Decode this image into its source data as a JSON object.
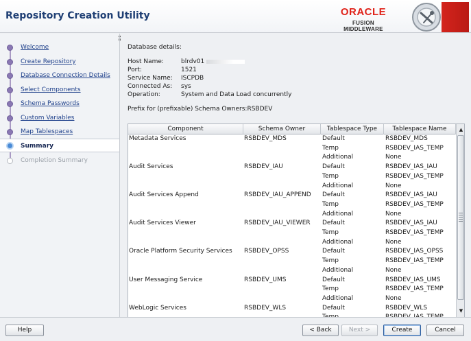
{
  "header": {
    "title": "Repository Creation Utility",
    "brand_primary": "ORACLE",
    "brand_secondary": "FUSION MIDDLEWARE",
    "brand_color": "#e0231a"
  },
  "nav": {
    "items": [
      {
        "label": "Welcome",
        "state": "done"
      },
      {
        "label": "Create Repository",
        "state": "done"
      },
      {
        "label": "Database Connection Details",
        "state": "done"
      },
      {
        "label": "Select Components",
        "state": "done"
      },
      {
        "label": "Schema Passwords",
        "state": "done"
      },
      {
        "label": "Custom Variables",
        "state": "done"
      },
      {
        "label": "Map Tablespaces",
        "state": "done"
      },
      {
        "label": "Summary",
        "state": "current"
      },
      {
        "label": "Completion Summary",
        "state": "pending"
      }
    ]
  },
  "details": {
    "heading": "Database details:",
    "rows": [
      {
        "key": "Host Name:",
        "value": "blrdv01"
      },
      {
        "key": "Port:",
        "value": "1521"
      },
      {
        "key": "Service Name:",
        "value": "ISCPDB"
      },
      {
        "key": "Connected As:",
        "value": "sys"
      },
      {
        "key": "Operation:",
        "value": "System and Data Load concurrently"
      }
    ],
    "prefix_line": "Prefix for (prefixable) Schema Owners:RSBDEV"
  },
  "table": {
    "columns": [
      "Component",
      "Schema Owner",
      "Tablespace Type",
      "Tablespace Name"
    ],
    "rows": [
      [
        "Metadata Services",
        "RSBDEV_MDS",
        "Default",
        "RSBDEV_MDS"
      ],
      [
        "",
        "",
        "Temp",
        "RSBDEV_IAS_TEMP"
      ],
      [
        "",
        "",
        "Additional",
        "None"
      ],
      [
        "Audit Services",
        "RSBDEV_IAU",
        "Default",
        "RSBDEV_IAS_IAU"
      ],
      [
        "",
        "",
        "Temp",
        "RSBDEV_IAS_TEMP"
      ],
      [
        "",
        "",
        "Additional",
        "None"
      ],
      [
        "Audit Services Append",
        "RSBDEV_IAU_APPEND",
        "Default",
        "RSBDEV_IAS_IAU"
      ],
      [
        "",
        "",
        "Temp",
        "RSBDEV_IAS_TEMP"
      ],
      [
        "",
        "",
        "Additional",
        "None"
      ],
      [
        "Audit Services Viewer",
        "RSBDEV_IAU_VIEWER",
        "Default",
        "RSBDEV_IAS_IAU"
      ],
      [
        "",
        "",
        "Temp",
        "RSBDEV_IAS_TEMP"
      ],
      [
        "",
        "",
        "Additional",
        "None"
      ],
      [
        "Oracle Platform Security Services",
        "RSBDEV_OPSS",
        "Default",
        "RSBDEV_IAS_OPSS"
      ],
      [
        "",
        "",
        "Temp",
        "RSBDEV_IAS_TEMP"
      ],
      [
        "",
        "",
        "Additional",
        "None"
      ],
      [
        "User Messaging Service",
        "RSBDEV_UMS",
        "Default",
        "RSBDEV_IAS_UMS"
      ],
      [
        "",
        "",
        "Temp",
        "RSBDEV_IAS_TEMP"
      ],
      [
        "",
        "",
        "Additional",
        "None"
      ],
      [
        "WebLogic Services",
        "RSBDEV_WLS",
        "Default",
        "RSBDEV_WLS"
      ],
      [
        "",
        "",
        "Temp",
        "RSBDEV_IAS_TEMP"
      ]
    ]
  },
  "footer": {
    "help": "Help",
    "back": "< Back",
    "next": "Next >",
    "create": "Create",
    "cancel": "Cancel"
  }
}
